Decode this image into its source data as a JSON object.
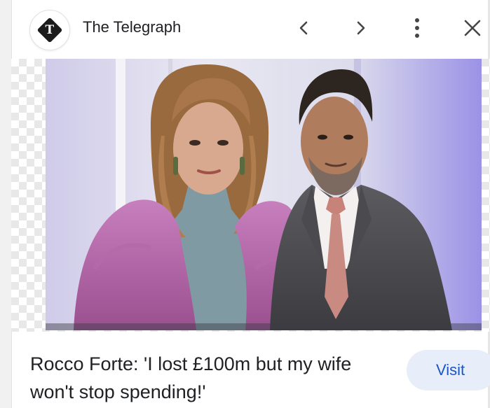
{
  "header": {
    "source_name": "The Telegraph",
    "logo_letter": "T",
    "icons": {
      "previous": "chevron-left-icon",
      "next": "chevron-right-icon",
      "more": "more-vertical-icon",
      "close": "close-icon"
    }
  },
  "article": {
    "headline": "Rocco Forte: 'I lost £100m but my wife won't stop spending!'",
    "visit_label": "Visit"
  },
  "colors": {
    "accent": "#1a56c5",
    "visit_bg": "#e8eef9",
    "text": "#202124",
    "icon": "#444746"
  }
}
